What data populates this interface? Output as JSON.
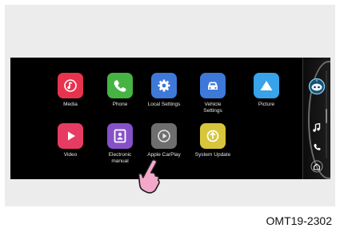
{
  "apps": [
    {
      "id": "media",
      "label": "Media",
      "color": "#e8334f",
      "icon": "music-note-icon"
    },
    {
      "id": "phone",
      "label": "Phone",
      "color": "#46b443",
      "icon": "phone-icon"
    },
    {
      "id": "local-settings",
      "label": "Local Settings",
      "color": "#3e78d8",
      "icon": "gear-icon"
    },
    {
      "id": "vehicle-settings",
      "label": "Vehicle\nSettings",
      "color": "#3e78d8",
      "icon": "car-icon"
    },
    {
      "id": "picture",
      "label": "Picture",
      "color": "#38a2ea",
      "icon": "mountain-icon"
    },
    {
      "id": "video",
      "label": "Video",
      "color": "#e63b63",
      "icon": "play-icon"
    },
    {
      "id": "electronic-manual",
      "label": "Electronic\nmanual",
      "color": "#8551c8",
      "icon": "manual-icon"
    },
    {
      "id": "apple-carplay",
      "label": "Apple CarPlay",
      "color": "#6e6e6e",
      "icon": "carplay-icon"
    },
    {
      "id": "system-update",
      "label": "System Update",
      "color": "#d7c53b",
      "icon": "update-icon"
    }
  ],
  "sidebar": {
    "icons": [
      "robot-assistant-icon",
      "music-note-icon",
      "phone-icon",
      "home-icon"
    ]
  },
  "pointer": {
    "icon": "hand-pointer-icon",
    "target": "Apple CarPlay"
  },
  "caption": "OMT19-2302"
}
